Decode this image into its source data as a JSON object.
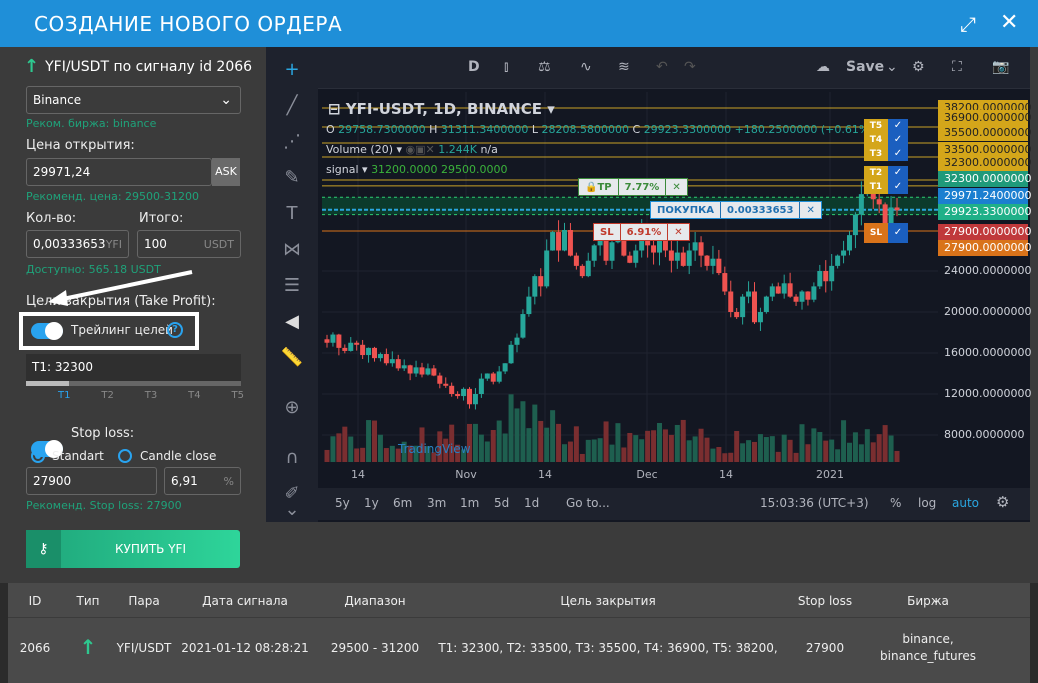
{
  "window": {
    "title": "СОЗДАНИЕ НОВОГО ОРДЕРА"
  },
  "form": {
    "heading": "YFI/USDT по сигналу id 2066",
    "exchange": "Binance",
    "exchange_hint": "Реком. биржа: binance",
    "open_price_label": "Цена открытия:",
    "open_price": "29971,24",
    "ask_label": "ASK",
    "price_hint": "Рекоменд. цена: 29500-31200",
    "qty_label": "Кол-во:",
    "qty": "0,00333653",
    "qty_unit": "YFI",
    "total_label": "Итого:",
    "total": "100",
    "total_unit": "USDT",
    "available": "Доступно: 565.18 USDT",
    "tp_label": "Цели закрытия (Take Profit):",
    "trailing_label": "Трейлинг целей",
    "trailing_on": true,
    "target_value": "T1: 32300",
    "target_ticks": [
      "T1",
      "T2",
      "T3",
      "T4",
      "T5"
    ],
    "target_selected": "T1",
    "sl_label": "Stop loss:",
    "sl_on": true,
    "sl_mode_standart": "Standart",
    "sl_mode_candle": "Candle close",
    "sl_mode_selected": "Standart",
    "sl_value": "27900",
    "sl_percent": "6,91",
    "sl_percent_unit": "%",
    "sl_hint": "Рекоменд. Stop loss: 27900",
    "buy_label": "КУПИТЬ YFI"
  },
  "chart": {
    "toolbar": {
      "interval": "D",
      "save": "Save"
    },
    "symbol": "YFI-USDT, 1D, BINANCE",
    "ohlc": {
      "o": "29758.7300000",
      "h": "31311.3400000",
      "l": "28208.5800000",
      "c": "29923.3300000",
      "change": "+180.2500000 (+0.61%)"
    },
    "volume": {
      "label": "Volume (20)",
      "value": "1.244K",
      "na": "n/a"
    },
    "signal": {
      "label": "signal",
      "v1": "31200.0000",
      "v2": "29500.0000"
    },
    "tp_chip": {
      "label": "TP",
      "pct": "7.77%"
    },
    "buy_chip": {
      "label": "ПОКУПКА",
      "qty": "0.00333653"
    },
    "sl_chip": {
      "label": "SL",
      "pct": "6.91%"
    },
    "targets": [
      "T5",
      "T4",
      "T3",
      "T2",
      "T1"
    ],
    "sl_tag": "SL",
    "price_labels": [
      {
        "text": "38200.0000000",
        "bg": "#d4a61a",
        "fg": "#222"
      },
      {
        "text": "36900.0000000",
        "bg": "#d4a61a",
        "fg": "#222"
      },
      {
        "text": "35500.0000000",
        "bg": "#d4a61a",
        "fg": "#222"
      },
      {
        "text": "33500.0000000",
        "bg": "#d4a61a",
        "fg": "#222"
      },
      {
        "text": "32300.0000000",
        "bg": "#d4a61a",
        "fg": "#222"
      },
      {
        "text": "32300.0000000",
        "bg": "#1f9a7a",
        "fg": "#fff"
      },
      {
        "text": "29971.2400000",
        "bg": "#1b7fd0",
        "fg": "#fff"
      },
      {
        "text": "29923.3300000",
        "bg": "#1fb088",
        "fg": "#fff"
      },
      {
        "text": "27900.0000000",
        "bg": "#c0393b",
        "fg": "#fff"
      },
      {
        "text": "27900.0000000",
        "bg": "#d9731a",
        "fg": "#fff"
      }
    ],
    "axis_ticks": [
      "24000.0000000",
      "20000.0000000",
      "16000.0000000",
      "12000.0000000",
      "8000.0000000"
    ],
    "time_ticks": [
      "14",
      "Nov",
      "14",
      "Dec",
      "14",
      "2021"
    ],
    "watermark": "TradingView",
    "ranges": [
      "5y",
      "1y",
      "6m",
      "3m",
      "1m",
      "5d",
      "1d"
    ],
    "goto": "Go to...",
    "clock": "15:03:36 (UTC+3)",
    "pct": "%",
    "log": "log",
    "auto": "auto",
    "colors": {
      "up": "#26a69a",
      "down": "#ef5350",
      "accent": "#1f8fd8"
    },
    "closes": [
      17000,
      17800,
      16500,
      16200,
      17000,
      16800,
      15800,
      16500,
      15500,
      15900,
      15000,
      15400,
      14500,
      14800,
      14000,
      14600,
      13900,
      14500,
      13800,
      13000,
      12800,
      12000,
      11800,
      12500,
      11000,
      12000,
      13500,
      14000,
      13200,
      14200,
      15000,
      16800,
      17500,
      19800,
      21500,
      23500,
      22500,
      26000,
      27800,
      26000,
      28000,
      25500,
      24500,
      23500,
      25000,
      26500,
      27000,
      25000,
      26800,
      27500,
      25500,
      24800,
      26000,
      27800,
      26500,
      25800,
      27000,
      26000,
      25000,
      25800,
      24500,
      26000,
      26800,
      25500,
      24500,
      25200,
      23800,
      22000,
      20000,
      19500,
      21500,
      22000,
      19000,
      20000,
      21500,
      22500,
      21800,
      22800,
      21500,
      21000,
      22000,
      21200,
      22500,
      24000,
      23000,
      24500,
      25500,
      26000,
      27500,
      29500,
      31500,
      32500,
      31000,
      30500,
      28500,
      30200,
      29923
    ]
  },
  "table": {
    "headers": [
      "ID",
      "Тип",
      "Пара",
      "Дата сигнала",
      "Диапазон",
      "Цель закрытия",
      "Stop loss",
      "Биржа"
    ],
    "row": {
      "id": "2066",
      "type": "long",
      "pair": "YFI/USDT",
      "date": "2021-01-12 08:28:21",
      "range": "29500 - 31200",
      "targets": "T1: 32300, T2: 33500, T3: 35500, T4: 36900, T5: 38200,",
      "sl": "27900",
      "exchange1": "binance,",
      "exchange2": "binance_futures"
    }
  }
}
